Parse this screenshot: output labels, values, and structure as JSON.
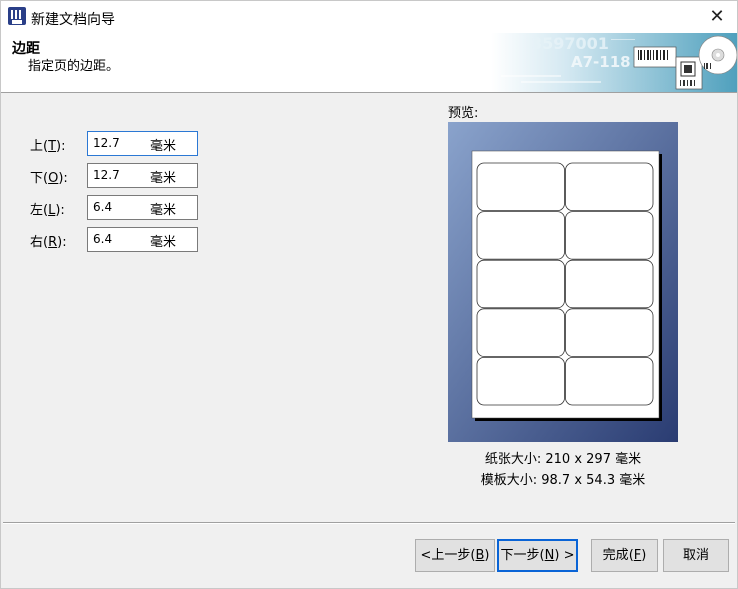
{
  "window": {
    "title": "新建文档向导",
    "close_glyph": "✕"
  },
  "header": {
    "title": "边距",
    "subtitle": "指定页的边距。",
    "art_text_1": "3597001",
    "art_text_2": "A7-118"
  },
  "margins": {
    "top": {
      "label": "上",
      "hotkey": "T",
      "value": "12.7",
      "unit": "毫米"
    },
    "bottom": {
      "label": "下",
      "hotkey": "O",
      "value": "12.7",
      "unit": "毫米"
    },
    "left": {
      "label": "左",
      "hotkey": "L",
      "value": "6.4",
      "unit": "毫米"
    },
    "right": {
      "label": "右",
      "hotkey": "R",
      "value": "6.4",
      "unit": "毫米"
    }
  },
  "preview": {
    "label": "预览:",
    "paper_size": "纸张大小: 210 x 297 毫米",
    "template_size": "模板大小: 98.7 x 54.3 毫米",
    "label_grid": {
      "columns": 2,
      "rows": 5
    }
  },
  "buttons": {
    "back": {
      "label": "<上一步",
      "hotkey": "B"
    },
    "next": {
      "label": "下一步",
      "hotkey": "N",
      "suffix": " >"
    },
    "finish": {
      "label": "完成",
      "hotkey": "F"
    },
    "cancel": {
      "label": "取消"
    }
  },
  "colors": {
    "accent": "#0a64d6",
    "preview_bg_dark": "#2a3c72",
    "preview_bg_light": "#8aa3cc"
  }
}
